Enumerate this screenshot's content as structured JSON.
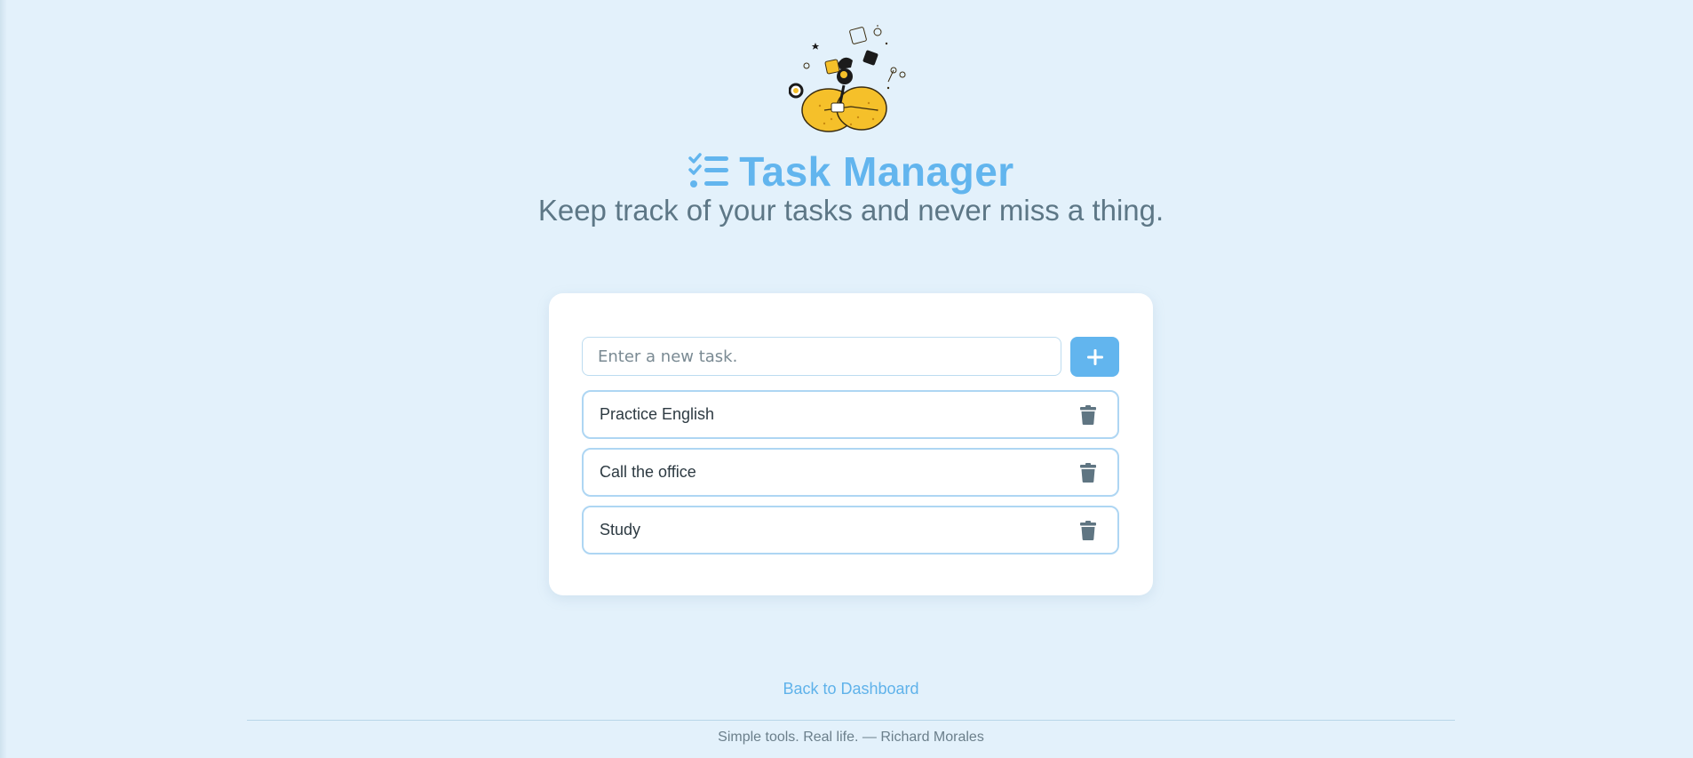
{
  "header": {
    "title": "Task Manager",
    "subtitle": "Keep track of your tasks and never miss a thing.",
    "title_icon": "list-check-icon",
    "illustration": "character-illustration"
  },
  "task_form": {
    "placeholder": "Enter a new task.",
    "add_icon": "plus-icon"
  },
  "tasks": [
    {
      "label": "Practice English",
      "delete_icon": "trash-icon"
    },
    {
      "label": "Call the office",
      "delete_icon": "trash-icon"
    },
    {
      "label": "Study",
      "delete_icon": "trash-icon"
    }
  ],
  "nav": {
    "back_label": "Back to Dashboard"
  },
  "footer": {
    "text": "Simple tools. Real life. — Richard Morales"
  },
  "colors": {
    "background": "#e3f1fb",
    "accent": "#62b5ee",
    "subtitle": "#5d7786",
    "task_border": "#aed6f3",
    "trash_icon": "#5f7582"
  }
}
